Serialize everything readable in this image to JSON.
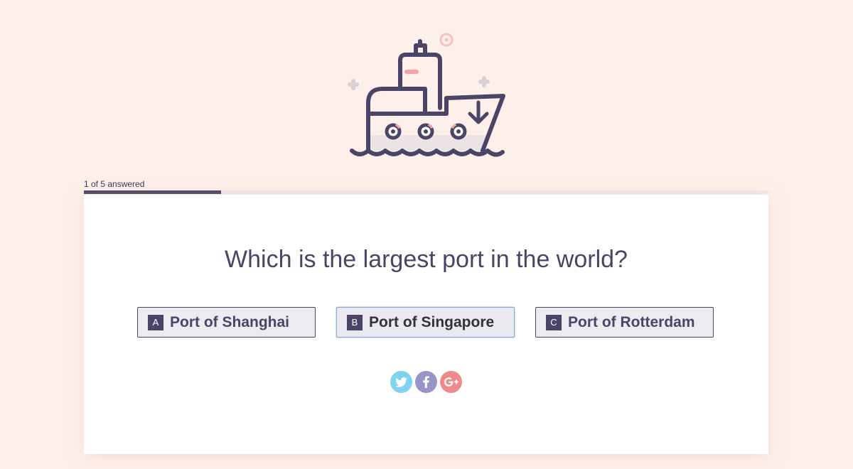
{
  "progress": {
    "label": "1 of 5 answered",
    "fraction": 0.2
  },
  "question": {
    "text": "Which is the largest port in the world?"
  },
  "answers": [
    {
      "key": "A",
      "label": "Port of Shanghai",
      "selected": false
    },
    {
      "key": "B",
      "label": "Port of Singapore",
      "selected": true
    },
    {
      "key": "C",
      "label": "Port of Rotterdam",
      "selected": false
    }
  ],
  "socials": [
    {
      "icon": "twitter-icon",
      "color": "#7fd3f0"
    },
    {
      "icon": "facebook-icon",
      "color": "#9894c8"
    },
    {
      "icon": "google-plus-icon",
      "color": "#f08a8a"
    }
  ],
  "hero": {
    "icon": "ship-icon"
  },
  "colors": {
    "background": "#fdf0ea",
    "accent": "#4a4566",
    "pink": "#f6a5a5"
  }
}
